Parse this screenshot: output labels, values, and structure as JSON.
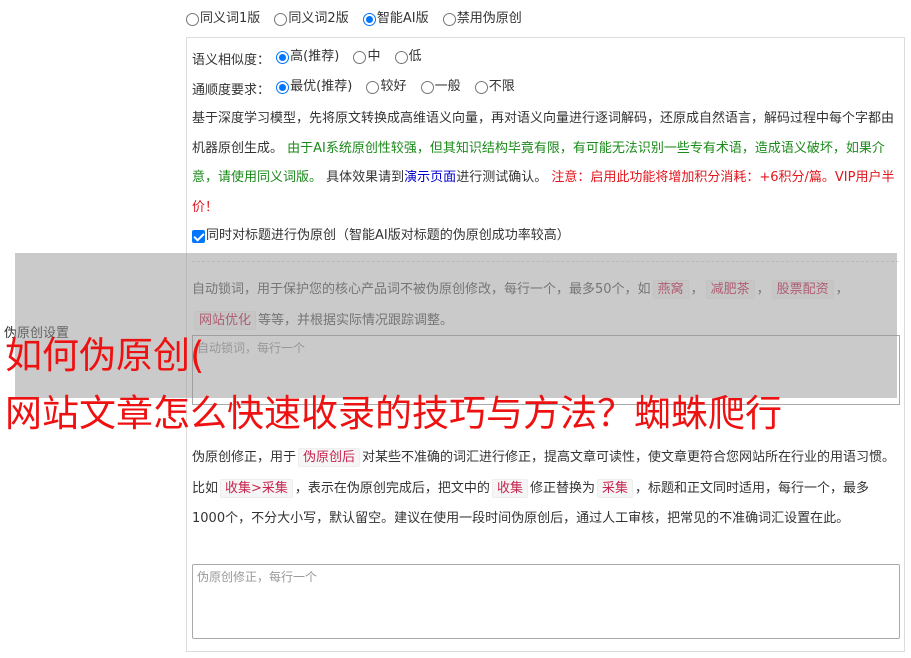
{
  "version_options": [
    {
      "label": "同义词1版",
      "selected": false
    },
    {
      "label": "同义词2版",
      "selected": false
    },
    {
      "label": "智能AI版",
      "selected": true
    },
    {
      "label": "禁用伪原创",
      "selected": false
    }
  ],
  "similarity": {
    "label": "语义相似度：",
    "options": [
      {
        "label": "高(推荐)",
        "selected": true
      },
      {
        "label": "中",
        "selected": false
      },
      {
        "label": "低",
        "selected": false
      }
    ]
  },
  "fluency": {
    "label": "通顺度要求：",
    "options": [
      {
        "label": "最优(推荐)",
        "selected": true
      },
      {
        "label": "较好",
        "selected": false
      },
      {
        "label": "一般",
        "selected": false
      },
      {
        "label": "不限",
        "selected": false
      }
    ]
  },
  "description": {
    "part1": "基于深度学习模型，先将原文转换成高维语义向量，再对语义向量进行逐词解码，还原成自然语言，解码过程中每个字都由机器原创生成。",
    "green": "由于AI系统原创性较强，但其知识结构毕竟有限，有可能无法识别一些专有术语，造成语义破坏，如果介意，请使用同义词版。",
    "part2": "具体效果请到",
    "link": "演示页面",
    "part3": "进行测试确认。",
    "red": "注意：启用此功能将增加积分消耗：+6积分/篇。VIP用户半价！"
  },
  "title_option": {
    "label": "同时对标题进行伪原创（智能AI版对标题的伪原创成功率较高）",
    "checked": true
  },
  "section_label": "伪原创设置",
  "lock": {
    "text1": "自动锁词，用于保护您的核心产品词不被伪原创修改，每行一个，最多50个，如",
    "tags": [
      "燕窝",
      "减肥茶",
      "股票配资",
      "网站优化"
    ],
    "text2": "等等，并根据实际情况跟踪调整。",
    "placeholder": "自动锁词，每行一个"
  },
  "fix": {
    "text1": "伪原创修正，用于",
    "tag1": "伪原创后",
    "text2": "对某些不准确的词汇进行修正，提高文章可读性，使文章更符合您网站所在行业的用语习惯。比如",
    "tag2": "收集>采集",
    "text3": "，表示在伪原创完成后，把文中的",
    "tag3": "收集",
    "text4": "修正替换为",
    "tag4": "采集",
    "text5": "，标题和正文同时适用，每行一个，最多1000个，不分大小写，默认留空。建议在使用一段时间伪原创后，通过人工审核，把常见的不准确词汇设置在此。",
    "placeholder": "伪原创修正，每行一个"
  },
  "overlay_title": {
    "line1": "如何伪原创(",
    "line2": "网站文章怎么快速收录的技巧与方法？蜘蛛爬行"
  }
}
